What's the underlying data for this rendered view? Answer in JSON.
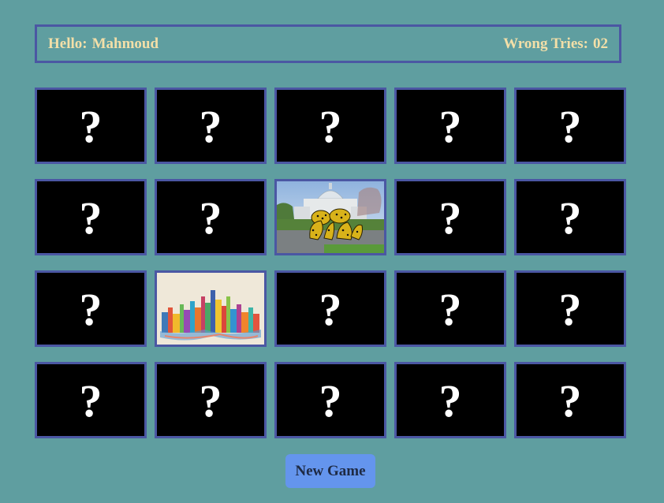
{
  "header": {
    "greeting_label": "Hello:",
    "player_name": "Mahmoud",
    "tries_label": "Wrong Tries:",
    "tries_value": "02"
  },
  "card_back_symbol": "?",
  "cards": [
    {
      "state": "hidden"
    },
    {
      "state": "hidden"
    },
    {
      "state": "hidden"
    },
    {
      "state": "hidden"
    },
    {
      "state": "hidden"
    },
    {
      "state": "hidden"
    },
    {
      "state": "hidden"
    },
    {
      "state": "flipped",
      "image": "garden-sculpture-photo"
    },
    {
      "state": "hidden"
    },
    {
      "state": "hidden"
    },
    {
      "state": "hidden"
    },
    {
      "state": "flipped",
      "image": "watercolor-skyline-photo"
    },
    {
      "state": "hidden"
    },
    {
      "state": "hidden"
    },
    {
      "state": "hidden"
    },
    {
      "state": "hidden"
    },
    {
      "state": "hidden"
    },
    {
      "state": "hidden"
    },
    {
      "state": "hidden"
    },
    {
      "state": "hidden"
    }
  ],
  "new_game_label": "New Game",
  "colors": {
    "background": "#5f9ea0",
    "border": "#4b57a3",
    "header_text": "#f3dfa8",
    "card_back": "#000000",
    "button": "#6495ed"
  }
}
